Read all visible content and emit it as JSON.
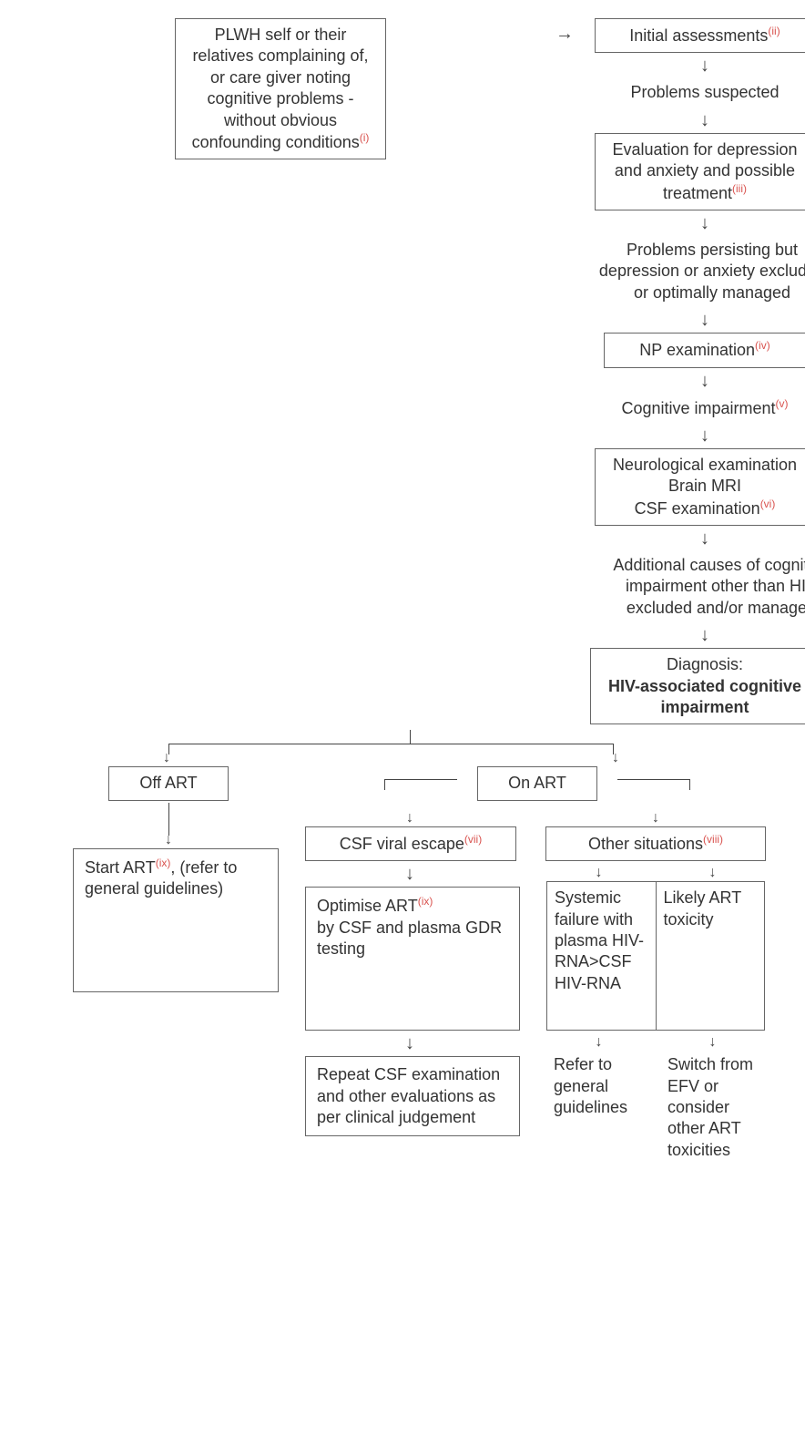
{
  "refs": {
    "i": "(i)",
    "ii": "(ii)",
    "iii": "(iii)",
    "iv": "(iv)",
    "v": "(v)",
    "vi": "(vi)",
    "vii": "(vii)",
    "viii": "(viii)",
    "ix": "(ix)"
  },
  "n1": "PLWH self or their relatives complain­ing of, or care giver noting cognitive problems - without obvious confounding conditions",
  "n2": "Initial assessments",
  "n3": "Problems suspected",
  "n4": "Evaluation for depression and anxiety and possible treatment",
  "n5": "Problems persisting but depression or anxiety excluded or optimally managed",
  "n6": "NP examination",
  "n7": "Cognitive impairment",
  "n8a": "Neurological examination",
  "n8b": "Brain MRI",
  "n8c": "CSF examination",
  "n9": "Additional causes of cognitive impairment other than HIV excluded and/or managed",
  "n10a": "Diagnosis:",
  "n10b": "HIV-associated cog­nitive impairment",
  "b_off": "Off ART",
  "b_on": "On ART",
  "b_csf": "CSF viral escape",
  "b_oth": "Other situations",
  "a_start_pre": "Start ART",
  "a_start_post": ", (refer to general guidelines)",
  "a_opt_pre": "Optimise ART",
  "a_opt_post": " by CSF and plasma GDR testing",
  "a_repeat": "Repeat CSF exam­ination and other evaluations as per clinical judgement",
  "a_sysfail": "Systemic failure with plasma HIV-RNA>CSF HIV-RNA",
  "a_tox": "Likely ART toxicity",
  "a_refer": "Refer to general guidelines",
  "a_switch": "Switch from EFV or consider other ART toxicities"
}
